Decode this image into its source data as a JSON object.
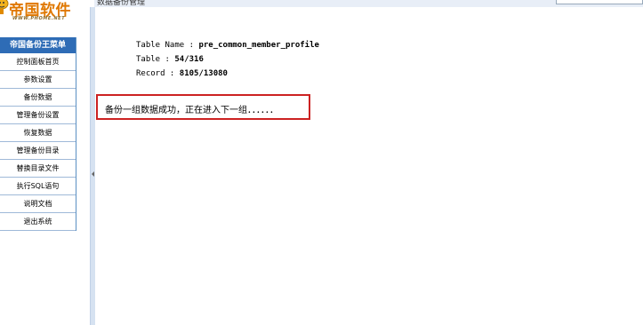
{
  "logo": {
    "brand": "帝国软件",
    "site": "WWW.PHOME.NET"
  },
  "topbar": {
    "caption": "数据备份管理",
    "search_text": ""
  },
  "menu": {
    "title": "帝国备份王菜单",
    "items": [
      {
        "label": "控制面板首页"
      },
      {
        "label": "参数设置"
      },
      {
        "label": "备份数据"
      },
      {
        "label": "管理备份设置"
      },
      {
        "label": "恢复数据"
      },
      {
        "label": "管理备份目录"
      },
      {
        "label": "替换目录文件"
      },
      {
        "label": "执行SQL语句"
      },
      {
        "label": "说明文档"
      },
      {
        "label": "退出系统"
      }
    ]
  },
  "progress": {
    "table_label": "Table Name : ",
    "table_value": "pre_common_member_profile",
    "count_label": "Table : ",
    "count_value": "54/316",
    "record_label": "Record : ",
    "record_value": "8105/13080"
  },
  "message": {
    "text": "备份一组数据成功，正在进入下一组．．．．．．"
  }
}
